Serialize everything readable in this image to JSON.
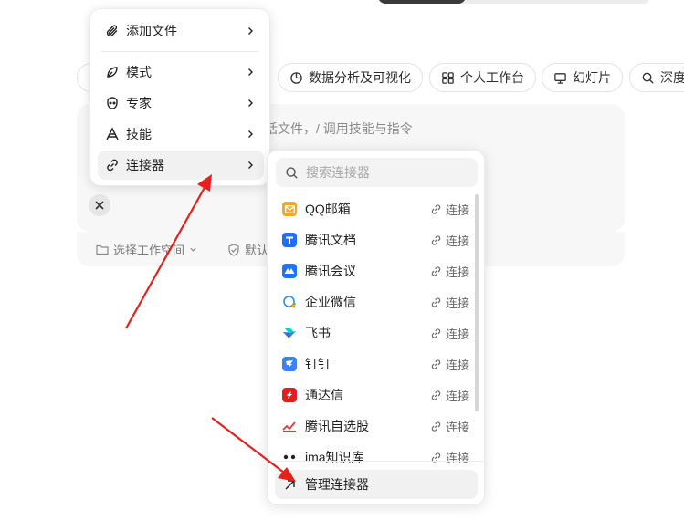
{
  "chips": [
    {
      "label": "数据分析及可视化",
      "icon": "pie-chart-icon"
    },
    {
      "label": "个人工作台",
      "icon": "grid-icon"
    },
    {
      "label": "幻灯片",
      "icon": "slides-icon"
    },
    {
      "label": "深度",
      "icon": "search-icon"
    }
  ],
  "composer": {
    "placeholder_tail": "话文件，/ 调用技能与指令",
    "workspace_label": "选择工作空间",
    "default_label": "默认"
  },
  "menu": {
    "items": [
      {
        "label": "添加文件",
        "icon": "paperclip-icon"
      },
      {
        "label": "模式",
        "icon": "leaf-icon"
      },
      {
        "label": "专家",
        "icon": "expert-icon"
      },
      {
        "label": "技能",
        "icon": "skill-icon"
      },
      {
        "label": "连接器",
        "icon": "link-icon"
      }
    ]
  },
  "connectors": {
    "search_placeholder": "搜索连接器",
    "connect_label": "连接",
    "items": [
      {
        "name": "QQ邮箱",
        "color": "#f5a623"
      },
      {
        "name": "腾讯文档",
        "color": "#1e6fff"
      },
      {
        "name": "腾讯会议",
        "color": "#1e74ff"
      },
      {
        "name": "企业微信",
        "color": "#2f8cff"
      },
      {
        "name": "飞书",
        "color": "#3370ff"
      },
      {
        "name": "钉钉",
        "color": "#3b82f6"
      },
      {
        "name": "通达信",
        "color": "#e02020"
      },
      {
        "name": "腾讯自选股",
        "color": "#e53935"
      },
      {
        "name": "ima知识库",
        "color": "#222222"
      }
    ],
    "manage_label": "管理连接器"
  },
  "colors": {
    "annotation_arrow": "#e8201b"
  }
}
